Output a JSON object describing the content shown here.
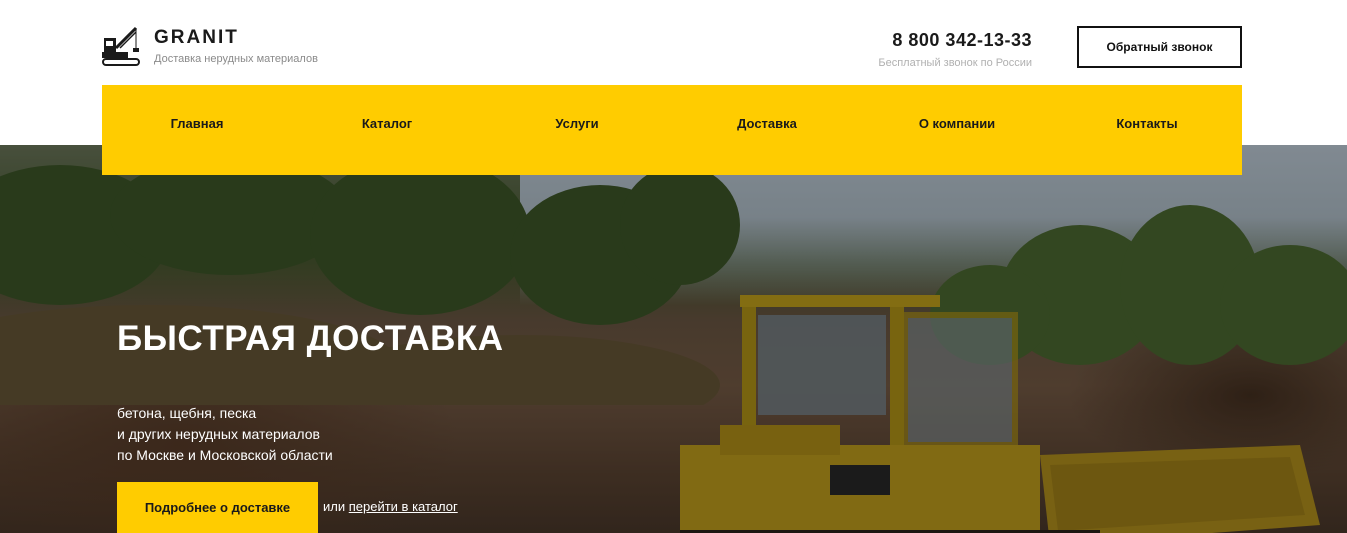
{
  "header": {
    "brand": "GRANIT",
    "tagline": "Доставка нерудных материалов",
    "phone": "8 800 342-13-33",
    "phone_note": "Бесплатный звонок по России",
    "callback_label": "Обратный звонок"
  },
  "nav": {
    "items": [
      {
        "label": "Главная"
      },
      {
        "label": "Каталог"
      },
      {
        "label": "Услуги"
      },
      {
        "label": "Доставка"
      },
      {
        "label": "О компании"
      },
      {
        "label": "Контакты"
      }
    ]
  },
  "hero": {
    "title": "БЫСТРАЯ ДОСТАВКА",
    "subtitle_lines": [
      "бетона, щебня, песка",
      "и других нерудных материалов",
      "по Москве и Московской области"
    ],
    "cta_label": "Подробнее о доставке",
    "or_text": "или",
    "catalog_link": "перейти в каталог"
  },
  "colors": {
    "accent": "#ffcc00",
    "text": "#1a1a1a",
    "muted": "#8a8a8a"
  },
  "icons": {
    "logo": "crane-icon"
  }
}
